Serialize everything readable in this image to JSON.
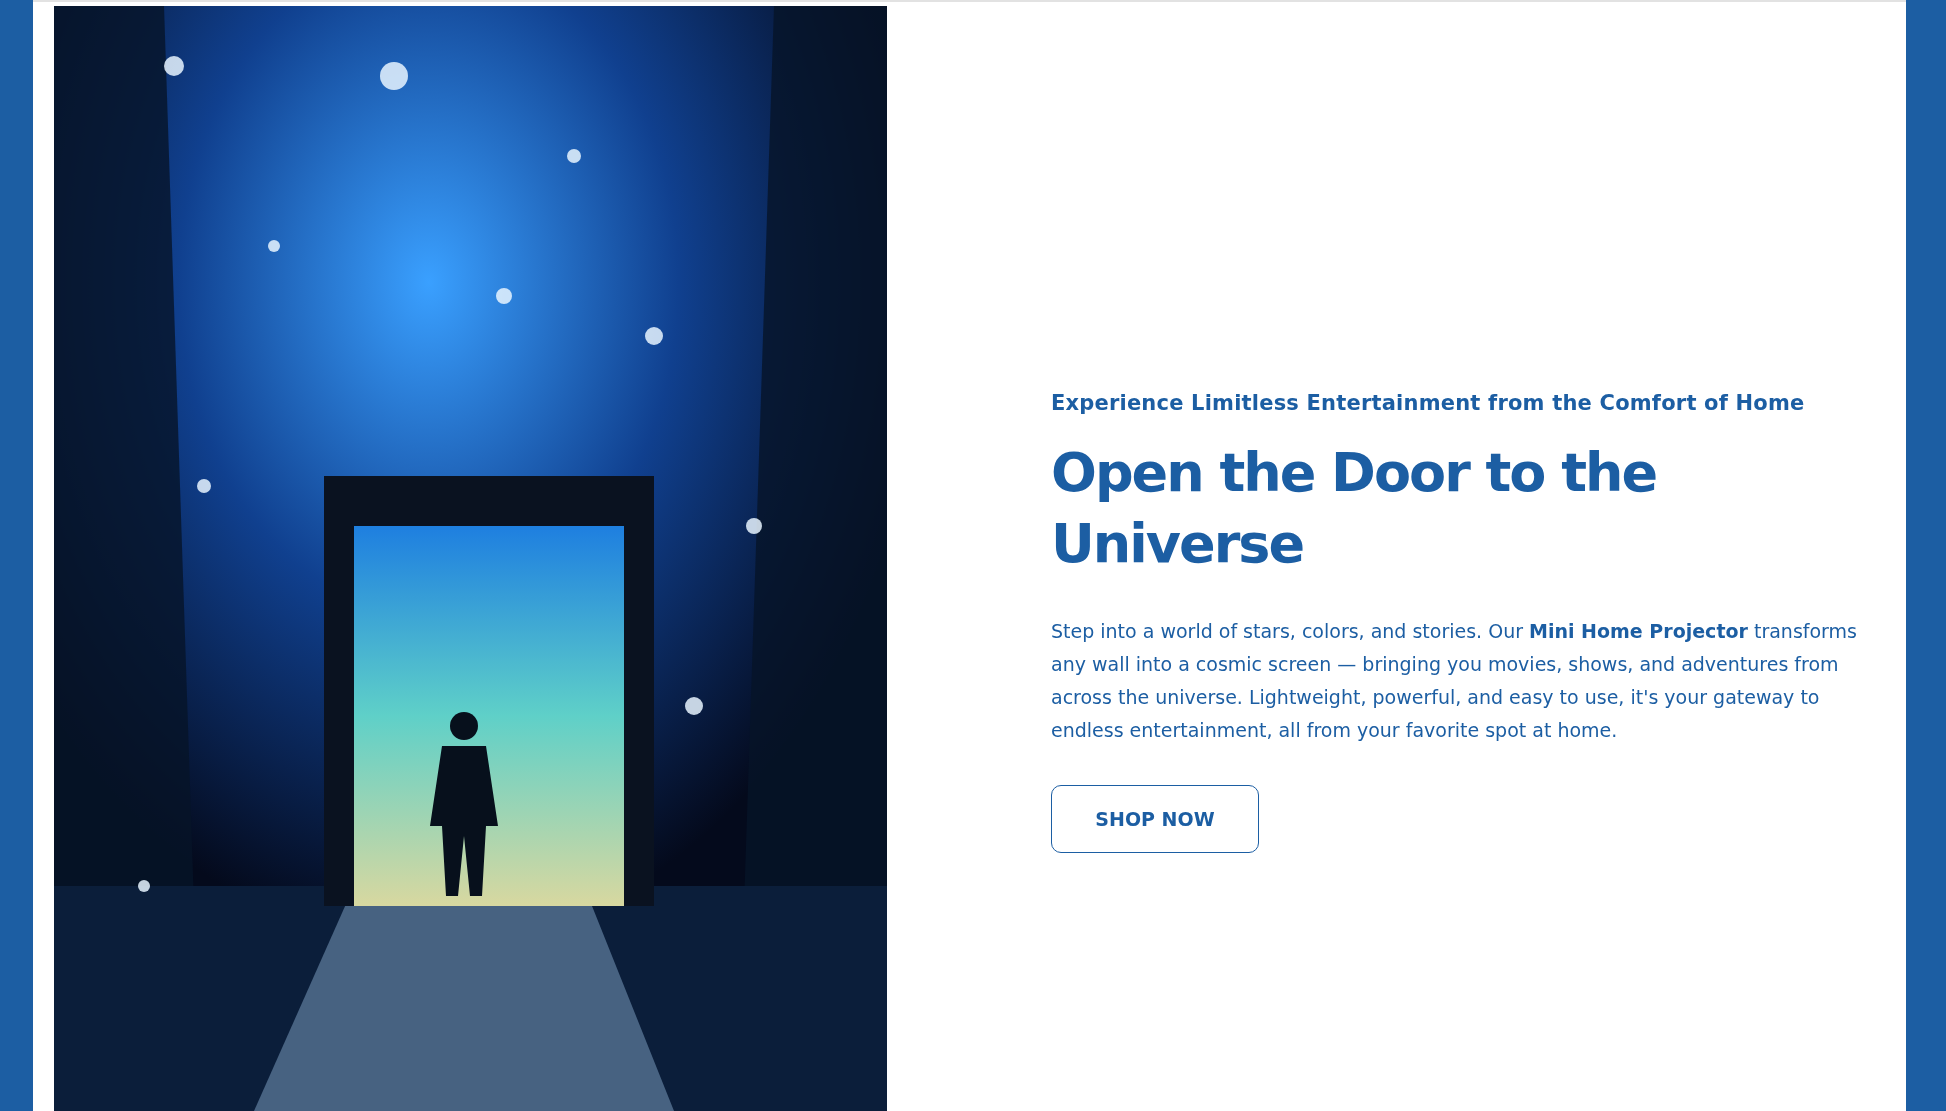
{
  "hero": {
    "eyebrow": "Experience Limitless Entertainment from the Comfort of Home",
    "title": "Open the Door to the Universe",
    "body": "Step into a world of stars, colors, and stories. Our **Mini Home Projector** transforms any wall into a cosmic screen — bringing you movies, shows, and adventures from across the universe. Lightweight, powerful, and easy to use, it's your gateway to endless entertainment, all from your favorite spot at home.",
    "button": "SHOP NOW"
  }
}
